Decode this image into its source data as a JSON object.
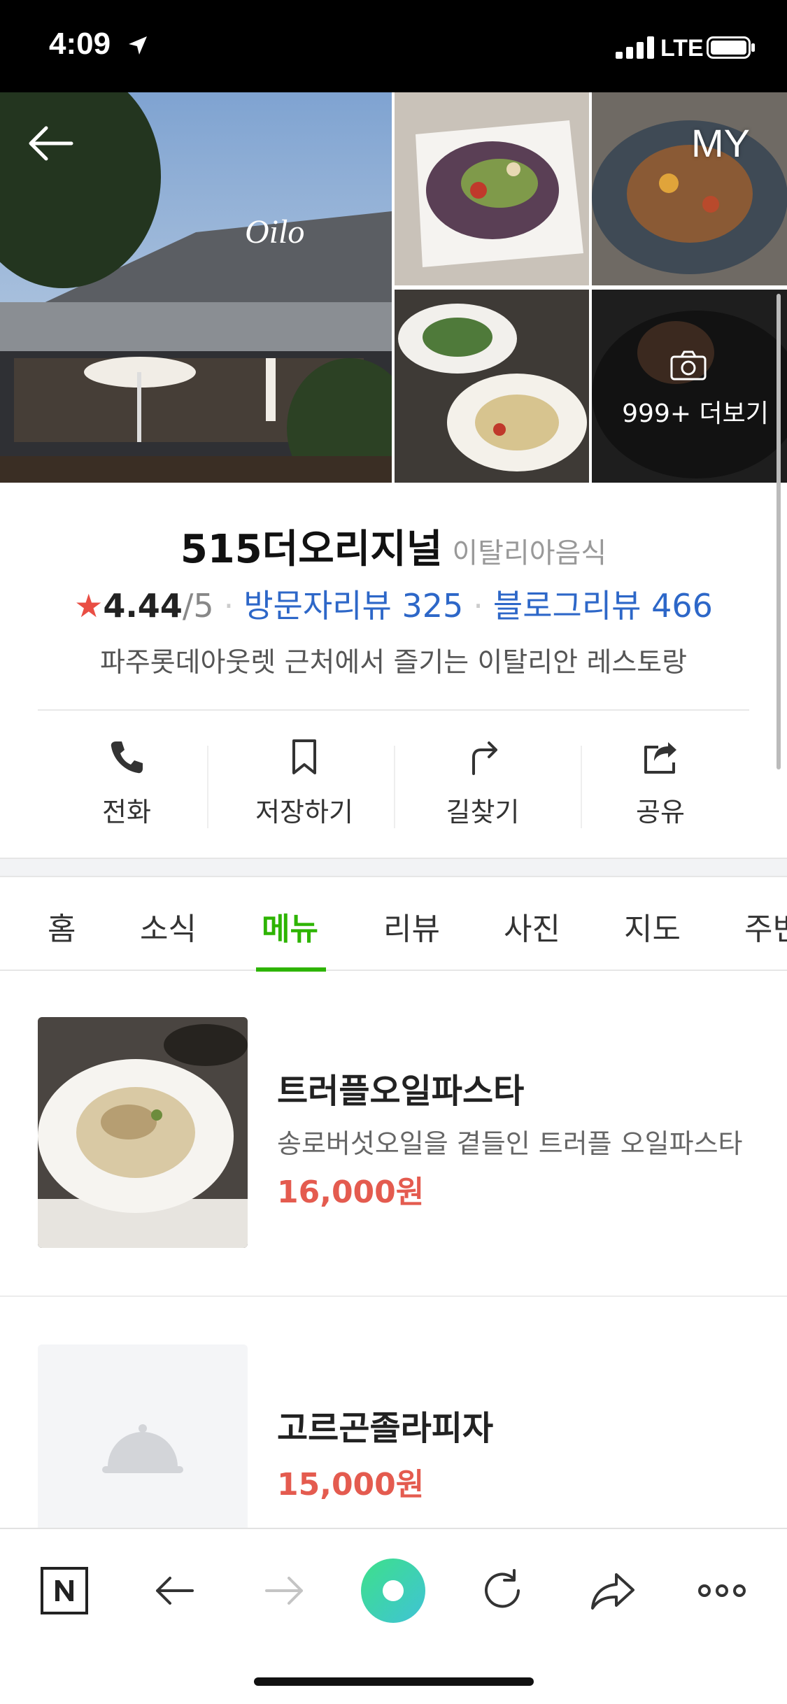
{
  "status_bar": {
    "time": "4:09",
    "network": "LTE"
  },
  "header": {
    "my_label": "MY",
    "more_photos_label": "999+ 더보기"
  },
  "place": {
    "name": "515더오리지널",
    "category": "이탈리아음식",
    "rating": "4.44",
    "rating_max": "/5",
    "visitor_reviews": "방문자리뷰 325",
    "blog_reviews": "블로그리뷰 466",
    "description": "파주롯데아웃렛 근처에서 즐기는 이탈리안 레스토랑"
  },
  "actions": [
    {
      "label": "전화",
      "icon": "phone-icon"
    },
    {
      "label": "저장하기",
      "icon": "bookmark-icon"
    },
    {
      "label": "길찾기",
      "icon": "directions-icon"
    },
    {
      "label": "공유",
      "icon": "share-icon"
    }
  ],
  "tabs": [
    {
      "label": "홈"
    },
    {
      "label": "소식"
    },
    {
      "label": "메뉴",
      "active": true
    },
    {
      "label": "리뷰"
    },
    {
      "label": "사진"
    },
    {
      "label": "지도"
    },
    {
      "label": "주변"
    }
  ],
  "menu_items": [
    {
      "name": "트러플오일파스타",
      "description": "송로버섯오일을 곁들인 트러플 오일파스타",
      "price": "16,000원"
    },
    {
      "name": "고르곤졸라피자",
      "description": "",
      "price": "15,000원"
    }
  ],
  "colors": {
    "accent_green": "#2db400",
    "price_red": "#e45b4f",
    "link_blue": "#2d67c8",
    "star_red": "#e94e44"
  }
}
